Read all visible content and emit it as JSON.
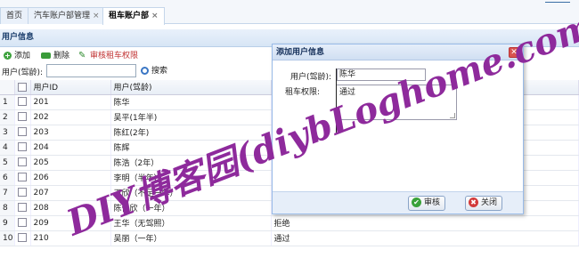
{
  "tabs": [
    {
      "label": "首页",
      "closable": false
    },
    {
      "label": "汽车账户部管理",
      "closable": true
    },
    {
      "label": "租车账户部",
      "closable": true,
      "active": true
    }
  ],
  "panel_title": "用户信息",
  "toolbar": {
    "add": "添加",
    "delete": "删除",
    "audit": "审核租车权限"
  },
  "search": {
    "label": "用户(驾龄):",
    "value": "",
    "button": "搜索"
  },
  "grid": {
    "columns": [
      "用户ID",
      "用户(驾龄)"
    ],
    "rows": [
      {
        "n": "1",
        "id": "201",
        "name": "陈华",
        "status": ""
      },
      {
        "n": "2",
        "id": "202",
        "name": "吴平(1年半)",
        "status": ""
      },
      {
        "n": "3",
        "id": "203",
        "name": "陈红(2年)",
        "status": ""
      },
      {
        "n": "4",
        "id": "204",
        "name": "陈辉",
        "status": ""
      },
      {
        "n": "5",
        "id": "205",
        "name": "陈浩（2年）",
        "status": ""
      },
      {
        "n": "6",
        "id": "206",
        "name": "李明（半年）",
        "status": ""
      },
      {
        "n": "7",
        "id": "207",
        "name": "王欣（不足一年）",
        "status": ""
      },
      {
        "n": "8",
        "id": "208",
        "name": "陈佳欣（一年）",
        "status": ""
      },
      {
        "n": "9",
        "id": "209",
        "name": "王华（无驾照）",
        "status": "拒绝"
      },
      {
        "n": "10",
        "id": "210",
        "name": "吴丽（一年）",
        "status": "通过"
      }
    ]
  },
  "dialog": {
    "title": "添加用户信息",
    "user_label": "用户(驾龄):",
    "user_value": "陈华",
    "perm_label": "租车权限:",
    "perm_value": "通过",
    "ok": "审核",
    "cancel": "关闭"
  },
  "watermark": "DIY博客园(diybLoghome.com)",
  "colors": {
    "watermark": "#8e2a9c",
    "accent": "#3a6ea5"
  }
}
